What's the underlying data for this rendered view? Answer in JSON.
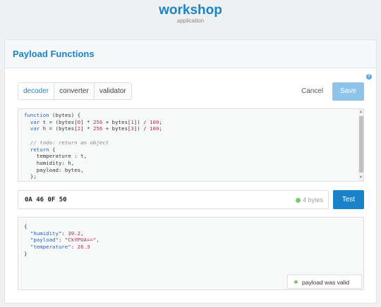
{
  "header": {
    "app_name": "workshop",
    "app_subtitle": "application"
  },
  "panel": {
    "title": "Payload Functions",
    "help_icon": "question-mark-icon"
  },
  "tabs": [
    {
      "label": "decoder",
      "active": true
    },
    {
      "label": "converter",
      "active": false
    },
    {
      "label": "validator",
      "active": false
    }
  ],
  "actions": {
    "cancel_label": "Cancel",
    "save_label": "Save"
  },
  "code": {
    "lines": [
      "function (bytes) {",
      "  var t = (bytes[0] * 256 + bytes[1]) / 100;",
      "  var h = (bytes[2] * 256 + bytes[3]) / 100;",
      "",
      "  // todo: return an object",
      "  return {",
      "    temperature : t,",
      "    humidity: h,",
      "    payload: bytes,",
      "  };",
      "}"
    ]
  },
  "payload": {
    "value": "0A 46 0F 50",
    "byte_count": "4 bytes"
  },
  "test_button": {
    "label": "Test"
  },
  "result": {
    "lines": [
      "{",
      "  \"humidity\": 39.2,",
      "  \"payload\": \"CkYPUA==\",",
      "  \"temperature\": 26.3",
      "}"
    ],
    "status": "payload was valid"
  },
  "colors": {
    "accent": "#1b84c5",
    "save_disabled": "#8fc4ea",
    "valid": "#78c96a"
  }
}
